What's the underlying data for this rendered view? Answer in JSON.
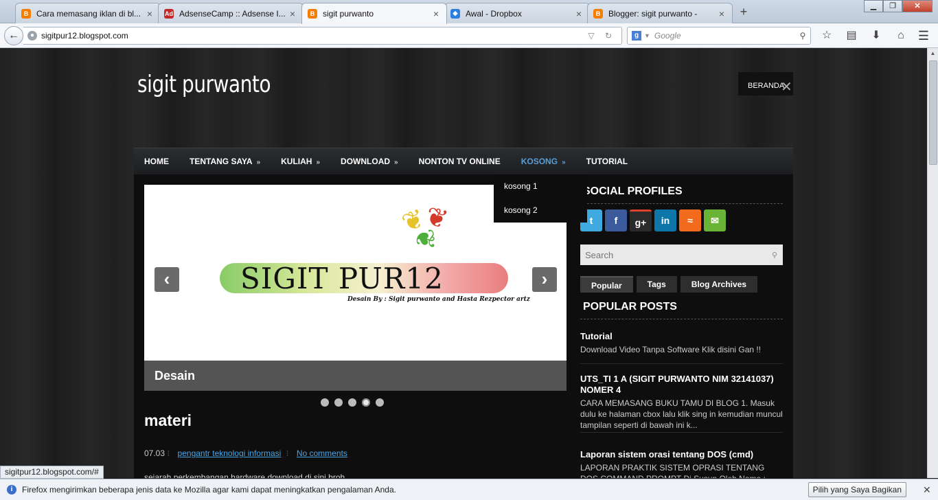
{
  "browser": {
    "tabs": [
      {
        "title": "Cara memasang iklan di bl...",
        "icon": "blogger-icon",
        "color": "#f57d00"
      },
      {
        "title": "AdsenseCamp :: Adsense I...",
        "icon": "adsensecamp-icon",
        "color": "#c62828"
      },
      {
        "title": "sigit purwanto",
        "icon": "blogger-icon",
        "color": "#f57d00",
        "active": true
      },
      {
        "title": "Awal - Dropbox",
        "icon": "dropbox-icon",
        "color": "#2b7fe0"
      },
      {
        "title": "Blogger: sigit purwanto -",
        "icon": "blogger-icon",
        "color": "#f57d00"
      }
    ],
    "new_tab": "+",
    "url": "sigitpur12.blogspot.com",
    "search_placeholder": "Google",
    "status_link": "sigitpur12.blogspot.com/#",
    "notification": {
      "text": "Firefox mengirimkan beberapa jenis data ke Mozilla agar kami dapat meningkatkan pengalaman Anda.",
      "button": "Pilih yang Saya Bagikan"
    }
  },
  "site": {
    "title": "sigit purwanto",
    "top_link": "BERANDA",
    "nav": [
      {
        "label": "HOME",
        "dropdown": false
      },
      {
        "label": "TENTANG SAYA",
        "dropdown": true
      },
      {
        "label": "KULIAH",
        "dropdown": true
      },
      {
        "label": "DOWNLOAD",
        "dropdown": true
      },
      {
        "label": "NONTON TV ONLINE",
        "dropdown": false
      },
      {
        "label": "KOSONG",
        "dropdown": true,
        "active": true
      },
      {
        "label": "TUTORIAL",
        "dropdown": false
      }
    ],
    "dropdown_items": [
      "kosong 1",
      "kosong 2"
    ],
    "slider": {
      "logo_text": "SIGIT PUR12",
      "logo_credit": "Desain By : Sigit purwanto and Hasta Rezpector artz",
      "caption": "Desain",
      "prev": "‹",
      "next": "›",
      "dot_count": 5,
      "active_dot": 4
    },
    "post": {
      "title": "materi",
      "date": "07.03",
      "category": "pengantr teknologi informasi",
      "comments": "No comments",
      "excerpt": "sejarah perkembangan hardware download di sini broh"
    }
  },
  "sidebar": {
    "social_heading": "SOCIAL PROFILES",
    "social_icons": [
      {
        "name": "twitter-icon",
        "color": "#3fa9e0",
        "glyph": "t"
      },
      {
        "name": "facebook-icon",
        "color": "#3b5b9d",
        "glyph": "f"
      },
      {
        "name": "google-plus-icon",
        "color": "#2b2b2b",
        "glyph": "g+"
      },
      {
        "name": "linkedin-icon",
        "color": "#0e76a8",
        "glyph": "in"
      },
      {
        "name": "rss-icon",
        "color": "#f26b1d",
        "glyph": "≈"
      },
      {
        "name": "email-icon",
        "color": "#69b337",
        "glyph": "✉"
      }
    ],
    "search_placeholder": "Search",
    "tabs": [
      "Popular",
      "Tags",
      "Blog Archives"
    ],
    "popular_heading": "POPULAR POSTS",
    "popular_posts": [
      {
        "title": "Tutorial",
        "excerpt": "Download Video Tanpa Software Klik disini Gan !!"
      },
      {
        "title": "UTS_TI 1 A (SIGIT PURWANTO NIM 32141037) NOMER 4",
        "excerpt": "CARA MEMASANG BUKU TAMU DI BLOG 1. Masuk dulu ke halaman cbox lalu klik sing in kemudian muncul tampilan seperti di bawah ini k..."
      },
      {
        "title": "Laporan sistem orasi tentang DOS (cmd)",
        "excerpt": "LAPORAN PRAKTIK SISTEM OPRASI TENTANG DOS COMMAND PROMPT Di Susun Oleh Nama :"
      }
    ]
  }
}
